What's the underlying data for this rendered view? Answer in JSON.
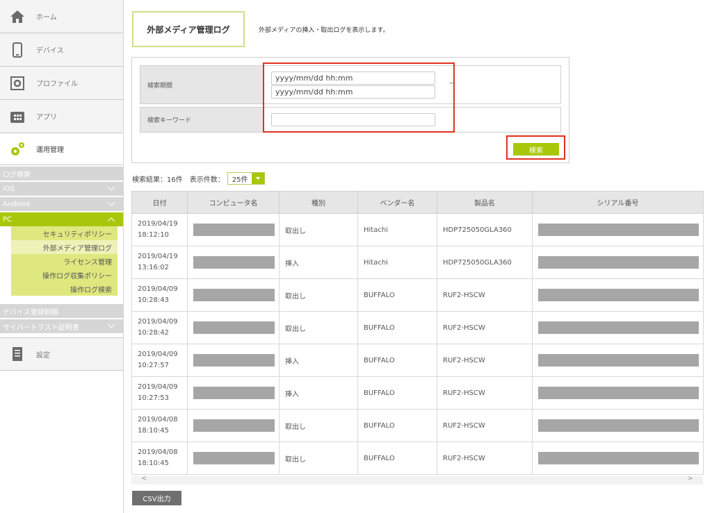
{
  "sidebar": {
    "home": "ホーム",
    "devices": "デバイス",
    "profiles": "プロファイル",
    "apps": "アプリ",
    "operations": "運用管理",
    "sections": {
      "log_search": "ログ検索",
      "ios": "iOS",
      "android": "Android",
      "pc": "PC",
      "device_registration": "デバイス登録制御",
      "cybertrust_cert": "サイバートラスト証明書"
    },
    "pc_items": [
      "セキュリティポリシー",
      "外部メディア管理ログ",
      "ライセンス管理",
      "操作ログ収集ポリシー",
      "操作ログ検索"
    ],
    "settings": "設定"
  },
  "header": {
    "title": "外部メディア管理ログ",
    "description": "外部メディアの挿入・取出ログを表示します。"
  },
  "search": {
    "period_label": "検索期間",
    "date_placeholder": "yyyy/mm/dd hh:mm",
    "tilde": "~",
    "keyword_label": "検索キーワード",
    "keyword_value": "",
    "button": "検索"
  },
  "results": {
    "count_text": "検索結果：16件",
    "per_page_label": "表示件数：",
    "per_page_value": "25件"
  },
  "table": {
    "headers": [
      "日付",
      "コンピュータ名",
      "種別",
      "ベンダー名",
      "製品名",
      "シリアル番号"
    ],
    "rows": [
      {
        "date": "2019/04/19",
        "time": "18:12:10",
        "type": "取出し",
        "vendor": "Hitachi",
        "product": "HDP725050GLA360"
      },
      {
        "date": "2019/04/19",
        "time": "13:16:02",
        "type": "挿入",
        "vendor": "Hitachi",
        "product": "HDP725050GLA360"
      },
      {
        "date": "2019/04/09",
        "time": "10:28:43",
        "type": "取出し",
        "vendor": "BUFFALO",
        "product": "RUF2-HSCW"
      },
      {
        "date": "2019/04/09",
        "time": "10:28:42",
        "type": "取出し",
        "vendor": "BUFFALO",
        "product": "RUF2-HSCW"
      },
      {
        "date": "2019/04/09",
        "time": "10:27:57",
        "type": "挿入",
        "vendor": "BUFFALO",
        "product": "RUF2-HSCW"
      },
      {
        "date": "2019/04/09",
        "time": "10:27:53",
        "type": "挿入",
        "vendor": "BUFFALO",
        "product": "RUF2-HSCW"
      },
      {
        "date": "2019/04/08",
        "time": "18:10:45",
        "type": "取出し",
        "vendor": "BUFFALO",
        "product": "RUF2-HSCW"
      },
      {
        "date": "2019/04/08",
        "time": "18:10:45",
        "type": "取出し",
        "vendor": "BUFFALO",
        "product": "RUF2-HSCW"
      }
    ]
  },
  "scroll": {
    "left": "<",
    "right": ">"
  },
  "csv_button": "CSV出力",
  "colors": {
    "accent": "#a9c70a",
    "highlight": "#e0301e"
  }
}
